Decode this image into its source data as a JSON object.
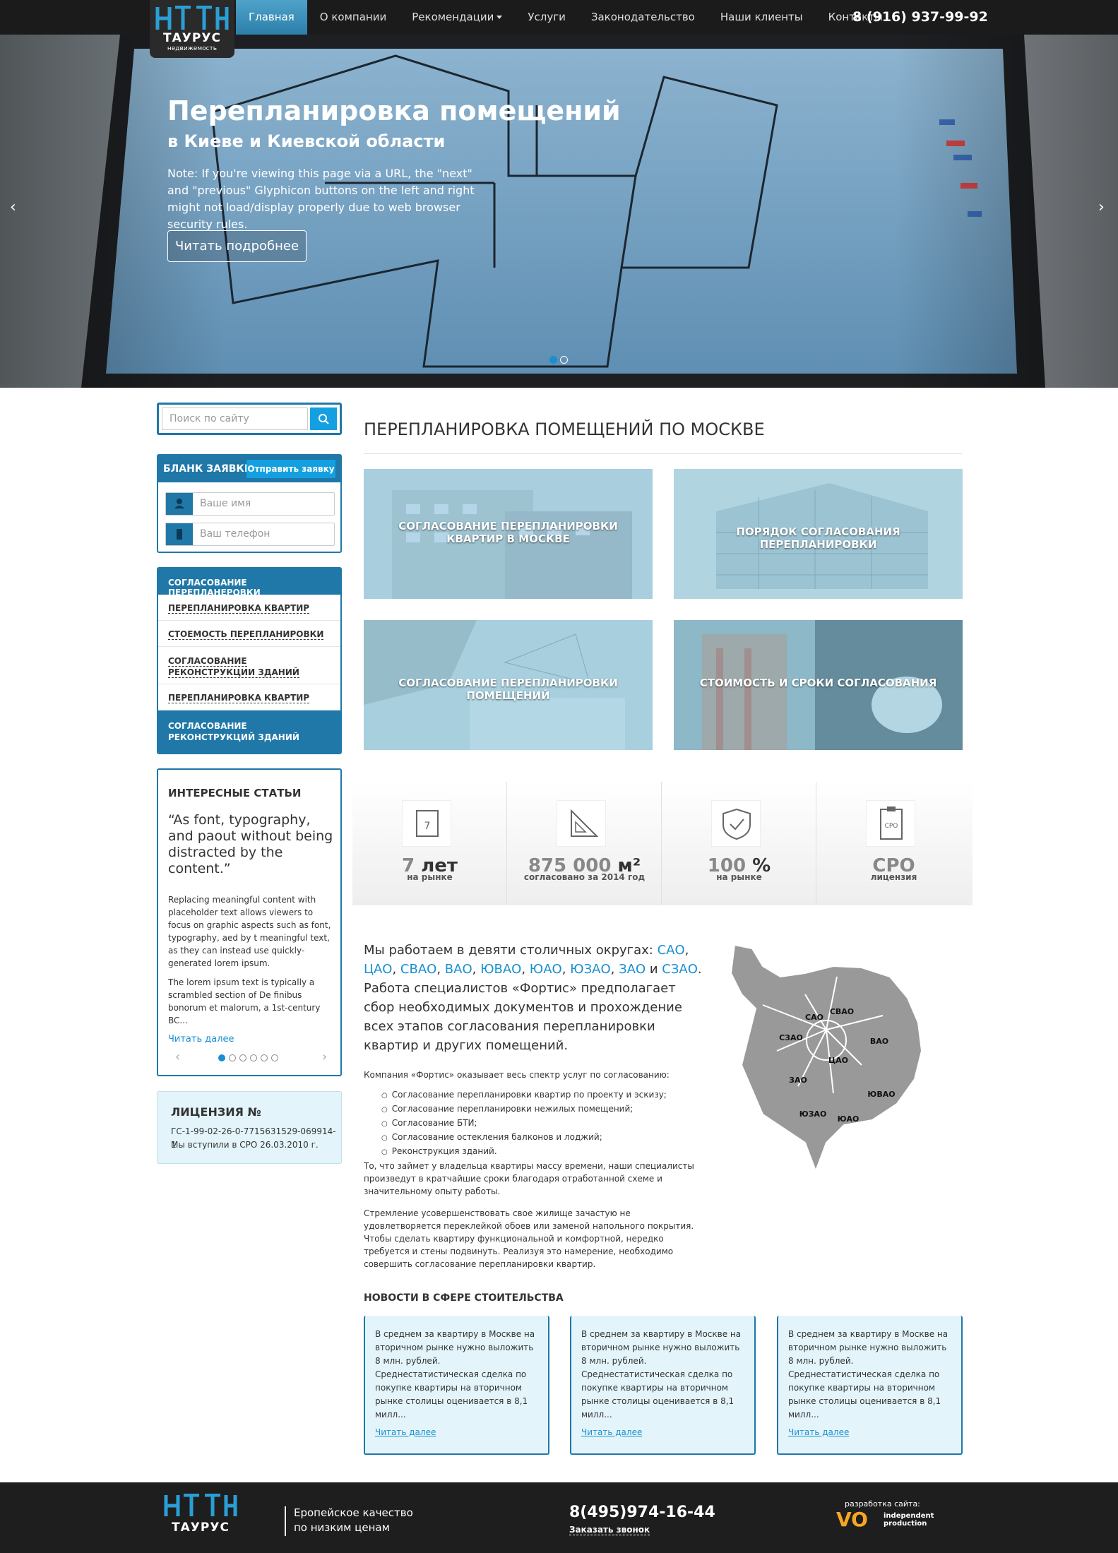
{
  "brand": {
    "name": "ТАУРУС",
    "subtitle": "недвижемость"
  },
  "nav": {
    "items": [
      "Главная",
      "О компании",
      "Рекомендации",
      "Услуги",
      "Законодательство",
      "Наши клиенты",
      "Контакты"
    ],
    "phone": "8 (916) 937-99-92"
  },
  "hero": {
    "title": "Перепланировка помещений",
    "subtitle": "в Киеве и Киевской области",
    "note": "Note: If you're viewing this page via a URL, the \"next\" and \"previous\" Glyphicon buttons on the left and right might not load/display properly due to web browser security rules.",
    "button": "Читать подробнее",
    "prev_icon": "‹",
    "next_icon": "›"
  },
  "sidebar": {
    "search_placeholder": "Поиск по сайту",
    "form": {
      "title": "БЛАНК ЗАЯВКИ",
      "send": "Отправить заявку",
      "name_placeholder": "Ваше имя",
      "phone_placeholder": "Ваш телефон"
    },
    "menu": [
      "СОГЛАСОВАНИЕ ПЕРЕПЛАНЕРОВКИ",
      "ПЕРЕПЛАНИРОВКА КВАРТИР",
      "СТОЕМОСТЬ ПЕРЕПЛАНИРОВКИ",
      "СОГЛАСОВАНИЕ РЕКОНСТРУКЦИИ ЗДАНИЙ",
      "ПЕРЕПЛАНИРОВКА КВАРТИР",
      "СОГЛАСОВАНИЕ РЕКОНСТРУКЦИЙ ЗДАНИЙ"
    ],
    "articles": {
      "title": "ИНТЕРЕСНЫЕ СТАТЬИ",
      "quote": "“As font, typography, and paout without being distracted by the content.”",
      "p1": "Replacing meaningful content with placeholder text allows viewers to focus on graphic aspects such as font, typography, aed by t meaningful text, as they can instead use quickly-generated lorem ipsum.",
      "p2": "The lorem ipsum text is typically a scrambled section of De finibus bonorum et malorum, a 1st-century BC...",
      "link": "Читать далее",
      "prev": "‹",
      "next": "›"
    },
    "license": {
      "title": "ЛИЦЕНЗИЯ №",
      "number": "ГС-1-99-02-26-0-7715631529-069914-1",
      "date": "Мы вступили в СРО 26.03.2010 г."
    }
  },
  "main": {
    "title": "ПЕРЕПЛАНИРОВКА ПОМЕЩЕНИЙ ПО МОСКВЕ",
    "tiles": [
      "СОГЛАСОВАНИЕ ПЕРЕПЛАНИРОВКИ КВАРТИР В МОСКВЕ",
      "ПОРЯДОК СОГЛАСОВАНИЯ ПЕРЕПЛАНИРОВКИ",
      "СОГЛАСОВАНИЕ ПЕРЕПЛАНИРОВКИ ПОМЕЩЕНИЙ",
      "СТОИМОСТЬ И СРОКИ СОГЛАСОВАНИЯ"
    ],
    "stats": [
      {
        "num": "7",
        "unit": "лет",
        "label": "на рынке",
        "icon": "calendar-icon"
      },
      {
        "num": "875 000",
        "unit": "м²",
        "label": "согласовано за 2014 год",
        "icon": "ruler-triangle-icon"
      },
      {
        "num": "100",
        "unit": "%",
        "label": "на рынке",
        "icon": "shield-check-icon"
      },
      {
        "num": "СРО",
        "unit": "",
        "label": "лицензия",
        "icon": "clipboard-sro-icon"
      }
    ],
    "intro": {
      "text1": "Мы работаем в девяти столичных округах: ",
      "districts": [
        "САО",
        "ЦАО",
        "СВАО",
        "ВАО",
        "ЮВАО",
        "ЮАО",
        "ЮЗАО",
        "ЗАО",
        "СЗАО"
      ],
      "and": "и",
      "text2": ". Работа специалистов «Фортис» предполагает сбор необходимых документов и прохождение всех этапов согласования перепланировки квартир и других помещений."
    },
    "services_intro": "Компания «Фортис» оказывает весь спектр услуг по согласованию:",
    "services": [
      "Согласование перепланировки квартир по проекту и эскизу;",
      "Согласование перепланировки нежилых помещений;",
      "Согласование БТИ;",
      "Согласование остекления балконов и лоджий;",
      "Реконструкция зданий."
    ],
    "p1": "То, что займет у владельца квартиры массу времени, наши специалисты произведут в кратчайшие сроки благодаря отработанной схеме и значительному опыту работы.",
    "p2": "Стремление усовершенствовать свое жилище зачастую не удовлетворяется переклейкой обоев или заменой напольного покрытия. Чтобы сделать квартиру функциональной и комфортной, нередко требуется и стены подвинуть. Реализуя это намерение, необходимо совершить согласование перепланировки квартир.",
    "map_labels": [
      "САО",
      "СВАО",
      "СЗАО",
      "ВАО",
      "ЦАО",
      "ЗАО",
      "ЮВАО",
      "ЮЗАО",
      "ЮАО"
    ],
    "news": {
      "title": "НОВОСТИ В СФЕРЕ СТОИТЕЛЬСТВА",
      "items": [
        {
          "text": "В среднем за квартиру в Москве на вторичном рынке нужно выложить 8 млн. рублей. Среднестатистическая сделка по покупке квартиры на вторичном рынке столицы оценивается в 8,1 милл...",
          "link": "Читать далее"
        },
        {
          "text": "В среднем за квартиру в Москве на вторичном рынке нужно выложить 8 млн. рублей. Среднестатистическая сделка по покупке квартиры на вторичном рынке столицы оценивается в 8,1 милл...",
          "link": "Читать далее"
        },
        {
          "text": "В среднем за квартиру в Москве на вторичном рынке нужно выложить 8 млн. рублей. Среднестатистическая сделка по покупке квартиры на вторичном рынке столицы оценивается в 8,1 милл...",
          "link": "Читать далее"
        }
      ]
    }
  },
  "footer": {
    "brand": "ТАУРУС",
    "slogan1": "Еропейское качество",
    "slogan2": "по низким ценам",
    "phone": "8(495)974-16-44",
    "call": "Заказать звонок",
    "dev_label": "разработка сайта:",
    "dev_logo": "VO",
    "dev_name1": "independent",
    "dev_name2": "production"
  }
}
